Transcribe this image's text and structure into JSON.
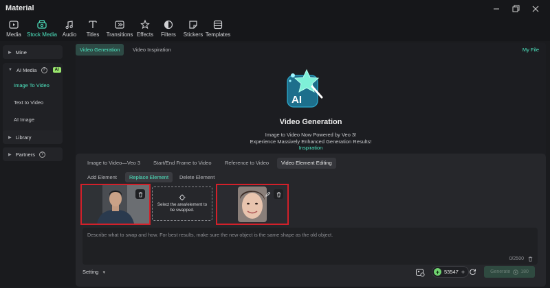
{
  "window": {
    "title": "Material"
  },
  "toolbar": {
    "items": [
      {
        "label": "Media",
        "icon": "media-icon"
      },
      {
        "label": "Stock Media",
        "icon": "stock-media-icon"
      },
      {
        "label": "Audio",
        "icon": "audio-icon"
      },
      {
        "label": "Titles",
        "icon": "titles-icon"
      },
      {
        "label": "Transitions",
        "icon": "transitions-icon"
      },
      {
        "label": "Effects",
        "icon": "effects-icon"
      },
      {
        "label": "Filters",
        "icon": "filters-icon"
      },
      {
        "label": "Stickers",
        "icon": "stickers-icon"
      },
      {
        "label": "Templates",
        "icon": "templates-icon"
      }
    ],
    "active": "Stock Media"
  },
  "sidebar": {
    "mine": "Mine",
    "ai_media": "AI Media",
    "ai_badge": "AI",
    "sub_items": [
      "Image To Video",
      "Text to Video",
      "AI Image"
    ],
    "active_sub": "Image To Video",
    "library": "Library",
    "partners": "Partners"
  },
  "main": {
    "tabs": [
      "Video Generation",
      "Video Inspiration"
    ],
    "active_tab": "Video Generation",
    "my_file": "My File",
    "hero": {
      "icon_text": "AI",
      "title": "Video Generation",
      "line1": "Image to Video Now Powered by Veo 3!",
      "line2": "Experience Massively Enhanced Generation Results!",
      "link": "Inspiration"
    }
  },
  "panel": {
    "mode_tabs": [
      "Image to Video—Veo 3",
      "Start/End Frame to Video",
      "Reference to Video",
      "Video Element Editing"
    ],
    "active_mode": "Video Element Editing",
    "edit_tabs": [
      "Add Element",
      "Replace Element",
      "Delete Element"
    ],
    "active_edit": "Replace Element",
    "select_area_text_1": "Select the area/element to",
    "select_area_text_2": "be swapped.",
    "prompt_placeholder": "Describe what to swap and how. For best results, make sure the new object is the same shape as the old object.",
    "char_count": "0/2500",
    "setting_label": "Setting",
    "credits": "53547",
    "generate_label": "Generate",
    "generate_cost": "180"
  },
  "colors": {
    "accent": "#4ee6c1",
    "highlight_border": "#d3202a",
    "background": "#1a1b1e"
  }
}
